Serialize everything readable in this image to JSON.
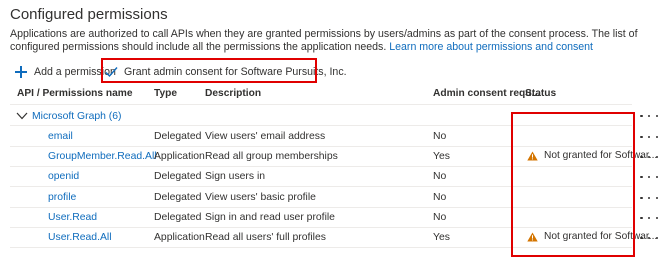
{
  "page": {
    "title": "Configured permissions",
    "description": "Applications are authorized to call APIs when they are granted permissions by users/admins as part of the consent process. The list of configured permissions should include all the permissions the application needs.",
    "learn_more_link": "Learn more about permissions and consent"
  },
  "toolbar": {
    "add_permission": "Add a permission",
    "grant_consent": "Grant admin consent for Software Pursuits, Inc."
  },
  "table": {
    "headers": {
      "api": "API / Permissions name",
      "type": "Type",
      "description": "Description",
      "admin_consent": "Admin consent requ...",
      "status": "Status"
    },
    "group": "Microsoft Graph (6)",
    "rows": [
      {
        "name": "email",
        "type": "Delegated",
        "description": "View users' email address",
        "admin_consent": "No",
        "status": ""
      },
      {
        "name": "GroupMember.Read.All",
        "type": "Application",
        "description": "Read all group memberships",
        "admin_consent": "Yes",
        "status": "Not granted for Softwar..."
      },
      {
        "name": "openid",
        "type": "Delegated",
        "description": "Sign users in",
        "admin_consent": "No",
        "status": ""
      },
      {
        "name": "profile",
        "type": "Delegated",
        "description": "View users' basic profile",
        "admin_consent": "No",
        "status": ""
      },
      {
        "name": "User.Read",
        "type": "Delegated",
        "description": "Sign in and read user profile",
        "admin_consent": "No",
        "status": ""
      },
      {
        "name": "User.Read.All",
        "type": "Application",
        "description": "Read all users' full profiles",
        "admin_consent": "Yes",
        "status": "Not granted for Softwar..."
      }
    ]
  },
  "colors": {
    "link": "#0f6cbd",
    "highlight": "#e00000",
    "warning": "#d47500"
  },
  "icons": {
    "add": "plus-icon",
    "grant": "checkmark-icon",
    "group_toggle": "chevron-down-icon",
    "status": "warning-icon",
    "row_actions": "more-icon"
  }
}
